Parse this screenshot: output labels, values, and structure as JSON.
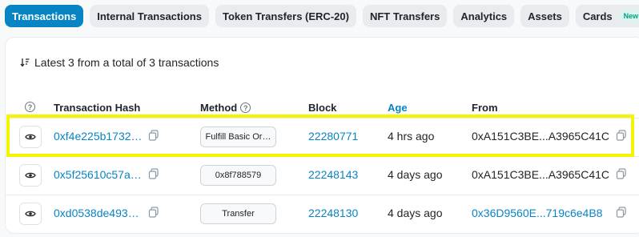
{
  "tabs": [
    {
      "label": "Transactions",
      "active": true
    },
    {
      "label": "Internal Transactions"
    },
    {
      "label": "Token Transfers (ERC-20)"
    },
    {
      "label": "NFT Transfers"
    },
    {
      "label": "Analytics"
    },
    {
      "label": "Assets"
    },
    {
      "label": "Cards",
      "badge": "New"
    }
  ],
  "summary": "Latest 3 from a total of 3 transactions",
  "columns": {
    "help": "?",
    "hash": "Transaction Hash",
    "method": "Method",
    "block": "Block",
    "age": "Age",
    "from": "From"
  },
  "rows": [
    {
      "hash": "0xf4e225b1732…",
      "method": "Fulfill Basic Or…",
      "block": "22280771",
      "age": "4 hrs ago",
      "from": "0xA151C3BE...A3965C41C",
      "from_is_link": false
    },
    {
      "hash": "0x5f25610c57a…",
      "method": "0x8f788579",
      "block": "22248143",
      "age": "4 days ago",
      "from": "0xA151C3BE...A3965C41C",
      "from_is_link": false
    },
    {
      "hash": "0xd0538de493…",
      "method": "Transfer",
      "block": "22248130",
      "age": "4 days ago",
      "from": "0x36D9560E...719c6e4B8",
      "from_is_link": true
    }
  ],
  "colors": {
    "accent": "#0784c3",
    "highlight": "#f5f500",
    "new_badge": "#00a186"
  }
}
